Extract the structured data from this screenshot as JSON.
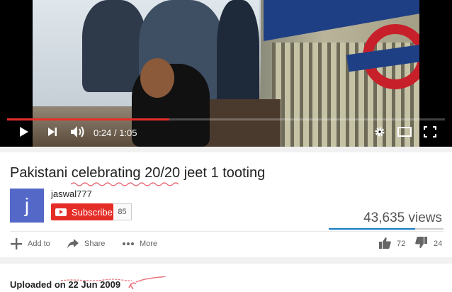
{
  "player": {
    "current_time": "0:24",
    "separator": "/",
    "duration": "1:05",
    "progress_fraction": 0.37,
    "icons": [
      "play-icon",
      "next-icon",
      "volume-icon",
      "settings-icon",
      "theater-mode-icon",
      "fullscreen-icon"
    ],
    "colors": {
      "progress": "#e52d27"
    }
  },
  "video": {
    "title": "Pakistani celebrating 20/20 jeet 1 tooting"
  },
  "channel": {
    "avatar_letter": "j",
    "name": "jaswal777",
    "subscribe_label": "Subscribe",
    "subscriber_count": "85",
    "avatar_color": "#5468c8"
  },
  "stats": {
    "views": "43,635 views",
    "like_fraction": 0.75,
    "likes": "72",
    "dislikes": "24"
  },
  "actions": {
    "add_to": "Add to",
    "share": "Share",
    "more": "More"
  },
  "description": {
    "uploaded": "Uploaded on 22 Jun 2009"
  },
  "colors": {
    "accent": "#e52d27",
    "like_bar": "#167ac6"
  }
}
